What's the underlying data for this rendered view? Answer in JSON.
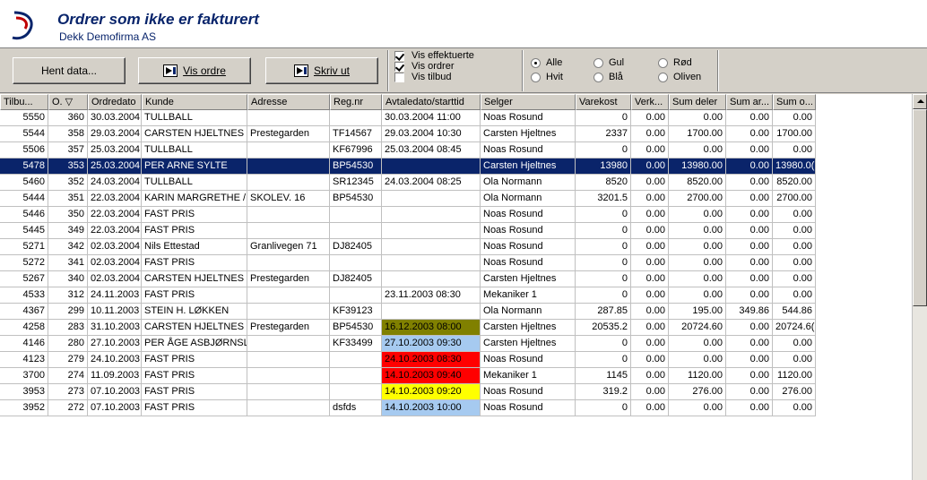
{
  "header": {
    "title": "Ordrer som ikke er fakturert",
    "company": "Dekk Demofirma AS"
  },
  "toolbar": {
    "fetch_label": "Hent data...",
    "show_order_label": "Vis ordre",
    "print_label": "Skriv ut",
    "checkboxes": [
      {
        "label": "Vis effektuerte",
        "checked": true
      },
      {
        "label": "Vis ordrer",
        "checked": true
      },
      {
        "label": "Vis tilbud",
        "checked": false
      }
    ],
    "radios": [
      {
        "label": "Alle",
        "selected": true
      },
      {
        "label": "Gul",
        "selected": false
      },
      {
        "label": "Rød",
        "selected": false
      },
      {
        "label": "Hvit",
        "selected": false
      },
      {
        "label": "Blå",
        "selected": false
      },
      {
        "label": "Oliven",
        "selected": false
      }
    ]
  },
  "grid": {
    "columns": [
      "Tilbu...",
      "O. ▽",
      "Ordredato",
      "Kunde",
      "Adresse",
      "Reg.nr",
      "Avtaledato/starttid",
      "Selger",
      "Varekost",
      "Verk...",
      "Sum deler",
      "Sum ar...",
      "Sum o..."
    ],
    "selected_row": 3,
    "rows": [
      {
        "cells": [
          "5550",
          "360",
          "30.03.2004",
          "TULLBALL",
          "",
          "",
          "30.03.2004 11:00",
          "Noas Rosund",
          "0",
          "0.00",
          "0.00",
          "0.00",
          "0.00"
        ],
        "avtale_color": ""
      },
      {
        "cells": [
          "5544",
          "358",
          "29.03.2004",
          "CARSTEN HJELTNES",
          "Prestegarden",
          "TF14567",
          "29.03.2004 10:30",
          "Carsten Hjeltnes",
          "2337",
          "0.00",
          "1700.00",
          "0.00",
          "1700.00"
        ],
        "avtale_color": ""
      },
      {
        "cells": [
          "5506",
          "357",
          "25.03.2004",
          "TULLBALL",
          "",
          "KF67996",
          "25.03.2004 08:45",
          "Noas Rosund",
          "0",
          "0.00",
          "0.00",
          "0.00",
          "0.00"
        ],
        "avtale_color": ""
      },
      {
        "cells": [
          "5478",
          "353",
          "25.03.2004",
          "PER ARNE SYLTE",
          "",
          "BP54530",
          "",
          "Carsten Hjeltnes",
          "13980",
          "0.00",
          "13980.00",
          "0.00",
          "13980.0("
        ],
        "avtale_color": ""
      },
      {
        "cells": [
          "5460",
          "352",
          "24.03.2004",
          "TULLBALL",
          "",
          "SR12345",
          "24.03.2004 08:25",
          "Ola Normann",
          "8520",
          "0.00",
          "8520.00",
          "0.00",
          "8520.00"
        ],
        "avtale_color": ""
      },
      {
        "cells": [
          "5444",
          "351",
          "22.03.2004",
          "KARIN MARGRETHE /",
          "SKOLEV. 16",
          "BP54530",
          "",
          "Ola Normann",
          "3201.5",
          "0.00",
          "2700.00",
          "0.00",
          "2700.00"
        ],
        "avtale_color": ""
      },
      {
        "cells": [
          "5446",
          "350",
          "22.03.2004",
          "FAST PRIS",
          "",
          "",
          "",
          "Noas Rosund",
          "0",
          "0.00",
          "0.00",
          "0.00",
          "0.00"
        ],
        "avtale_color": ""
      },
      {
        "cells": [
          "5445",
          "349",
          "22.03.2004",
          "FAST PRIS",
          "",
          "",
          "",
          "Noas Rosund",
          "0",
          "0.00",
          "0.00",
          "0.00",
          "0.00"
        ],
        "avtale_color": ""
      },
      {
        "cells": [
          "5271",
          "342",
          "02.03.2004",
          "Nils Ettestad",
          "Granlivegen 71",
          "DJ82405",
          "",
          "Noas Rosund",
          "0",
          "0.00",
          "0.00",
          "0.00",
          "0.00"
        ],
        "avtale_color": ""
      },
      {
        "cells": [
          "5272",
          "341",
          "02.03.2004",
          "FAST PRIS",
          "",
          "",
          "",
          "Noas Rosund",
          "0",
          "0.00",
          "0.00",
          "0.00",
          "0.00"
        ],
        "avtale_color": ""
      },
      {
        "cells": [
          "5267",
          "340",
          "02.03.2004",
          "CARSTEN HJELTNES",
          "Prestegarden",
          "DJ82405",
          "",
          "Carsten Hjeltnes",
          "0",
          "0.00",
          "0.00",
          "0.00",
          "0.00"
        ],
        "avtale_color": ""
      },
      {
        "cells": [
          "4533",
          "312",
          "24.11.2003",
          "FAST PRIS",
          "",
          "",
          "23.11.2003 08:30",
          "Mekaniker 1",
          "0",
          "0.00",
          "0.00",
          "0.00",
          "0.00"
        ],
        "avtale_color": ""
      },
      {
        "cells": [
          "4367",
          "299",
          "10.11.2003",
          "STEIN H. LØKKEN",
          "",
          "KF39123",
          "",
          "Ola Normann",
          "287.85",
          "0.00",
          "195.00",
          "349.86",
          "544.86"
        ],
        "avtale_color": ""
      },
      {
        "cells": [
          "4258",
          "283",
          "31.10.2003",
          "CARSTEN HJELTNES",
          "Prestegarden",
          "BP54530",
          "16.12.2003 08:00",
          "Carsten Hjeltnes",
          "20535.2",
          "0.00",
          "20724.60",
          "0.00",
          "20724.6("
        ],
        "avtale_color": "#808000"
      },
      {
        "cells": [
          "4146",
          "280",
          "27.10.2003",
          "PER ÅGE ASBJØRNSL",
          "",
          "KF33499",
          "27.10.2003 09:30",
          "Carsten Hjeltnes",
          "0",
          "0.00",
          "0.00",
          "0.00",
          "0.00"
        ],
        "avtale_color": "#a6caf0"
      },
      {
        "cells": [
          "4123",
          "279",
          "24.10.2003",
          "FAST PRIS",
          "",
          "",
          "24.10.2003 08:30",
          "Noas Rosund",
          "0",
          "0.00",
          "0.00",
          "0.00",
          "0.00"
        ],
        "avtale_color": "#ff0000"
      },
      {
        "cells": [
          "3700",
          "274",
          "11.09.2003",
          "FAST PRIS",
          "",
          "",
          "14.10.2003 09:40",
          "Mekaniker 1",
          "1145",
          "0.00",
          "1120.00",
          "0.00",
          "1120.00"
        ],
        "avtale_color": "#ff0000"
      },
      {
        "cells": [
          "3953",
          "273",
          "07.10.2003",
          "FAST PRIS",
          "",
          "",
          "14.10.2003 09:20",
          "Noas Rosund",
          "319.2",
          "0.00",
          "276.00",
          "0.00",
          "276.00"
        ],
        "avtale_color": "#ffff00"
      },
      {
        "cells": [
          "3952",
          "272",
          "07.10.2003",
          "FAST PRIS",
          "",
          "dsfds",
          "14.10.2003 10:00",
          "Noas Rosund",
          "0",
          "0.00",
          "0.00",
          "0.00",
          "0.00"
        ],
        "avtale_color": "#a6caf0"
      }
    ]
  }
}
